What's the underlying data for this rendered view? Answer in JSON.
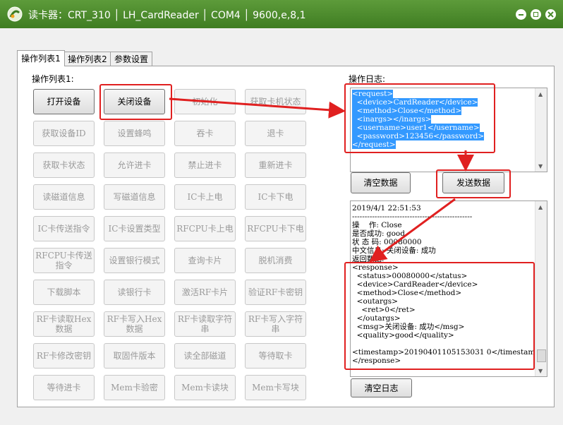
{
  "window": {
    "title": "读卡器：CRT_310 │ LH_CardReader │ COM4 │ 9600,e,8,1"
  },
  "tabs": [
    {
      "label": "操作列表1"
    },
    {
      "label": "操作列表2"
    },
    {
      "label": "参数设置"
    }
  ],
  "ops_label": "操作列表1:",
  "log_label": "操作日志:",
  "buttons": [
    {
      "label": "打开设备"
    },
    {
      "label": "关闭设备"
    },
    {
      "label": "初始化"
    },
    {
      "label": "获取卡机状态"
    },
    {
      "label": "获取设备ID"
    },
    {
      "label": "设置蜂鸣"
    },
    {
      "label": "吞卡"
    },
    {
      "label": "退卡"
    },
    {
      "label": "获取卡状态"
    },
    {
      "label": "允许进卡"
    },
    {
      "label": "禁止进卡"
    },
    {
      "label": "重新进卡"
    },
    {
      "label": "读磁道信息"
    },
    {
      "label": "写磁道信息"
    },
    {
      "label": "IC卡上电"
    },
    {
      "label": "IC卡下电"
    },
    {
      "label": "IC卡传送指令"
    },
    {
      "label": "IC卡设置类型"
    },
    {
      "label": "RFCPU卡上电"
    },
    {
      "label": "RFCPU卡下电"
    },
    {
      "label": "RFCPU卡传送\n指令"
    },
    {
      "label": "设置银行模式"
    },
    {
      "label": "查询卡片"
    },
    {
      "label": "脱机消费"
    },
    {
      "label": "下载脚本"
    },
    {
      "label": "读银行卡"
    },
    {
      "label": "激活RF卡片"
    },
    {
      "label": "验证RF卡密钥"
    },
    {
      "label": "RF卡读取Hex\n数据"
    },
    {
      "label": "RF卡写入Hex\n数据"
    },
    {
      "label": "RF卡读取字符\n串"
    },
    {
      "label": "RF卡写入字符\n串"
    },
    {
      "label": "RF卡修改密钥"
    },
    {
      "label": "取固件版本"
    },
    {
      "label": "读全部磁道"
    },
    {
      "label": "等待取卡"
    },
    {
      "label": "等待进卡"
    },
    {
      "label": "Mem卡验密"
    },
    {
      "label": "Mem卡读块"
    },
    {
      "label": "Mem卡写块"
    }
  ],
  "request_lines": [
    "<request>",
    "  <device>CardReader</device>",
    "  <method>Close</method>",
    "  <inargs></inargs>",
    "  <username>user1</username>",
    "  <password>123456</password>",
    "</request>"
  ],
  "clear_data_label": "清空数据",
  "send_data_label": "发送数据",
  "log_lines": [
    "2019/4/1 22:51:53",
    "------------------------------------------------",
    "操    作: Close",
    "是否成功: good",
    "状 态 码: 00080000",
    "中文信息: 关闭设备: 成功",
    "返回数据:",
    "<response>",
    "  <status>00080000</status>",
    "  <device>CardReader</device>",
    "  <method>Close</method>",
    "  <outargs>",
    "    <ret>0</ret>",
    "  </outargs>",
    "  <msg>关闭设备: 成功</msg>",
    "  <quality>good</quality>",
    "",
    "<timestamp>20190401105153031 0</timestamp>",
    "</response>"
  ],
  "clear_log_label": "清空日志",
  "colors": {
    "titlebar": "#4a8a2c",
    "highlight": "#e02020",
    "selection": "#3399ff"
  }
}
